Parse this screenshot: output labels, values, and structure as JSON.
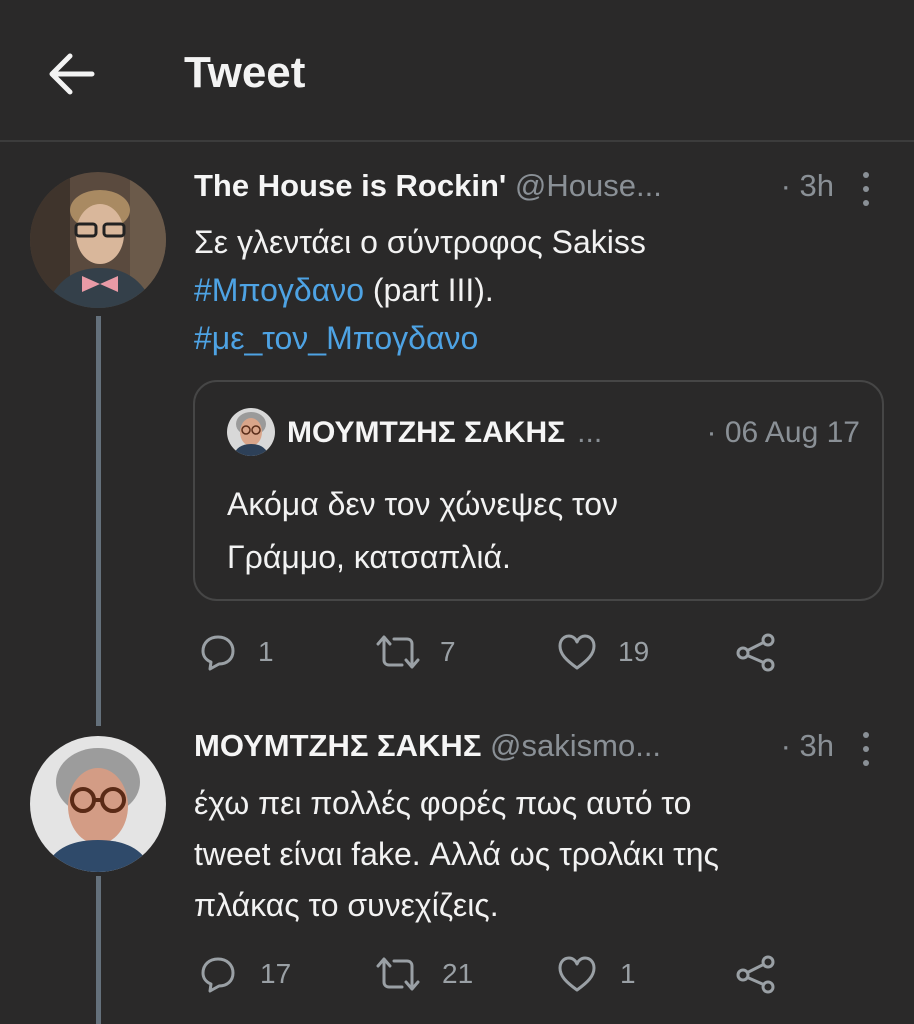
{
  "header": {
    "title": "Tweet"
  },
  "tweets": [
    {
      "name": "The House is Rockin'",
      "handle": "@House...",
      "time": "· 3h",
      "text_line1": "Σε γλεντάει ο σύντροφος Sakiss",
      "hashtag1": "#Μπογδανο",
      "text_after_hashtag1": " (part III).",
      "hashtag2": "#με_τον_Μπογδανο",
      "quote": {
        "name": "ΜΟΥΜΤΖΗΣ ΣΑΚΗΣ",
        "ellipsis": "...",
        "time": "· 06 Aug 17",
        "line1": "Ακόμα δεν τον χώνεψες τον",
        "line2": "Γράμμο, κατσαπλιά."
      },
      "replies": "1",
      "retweets": "7",
      "likes": "19"
    },
    {
      "name": "ΜΟΥΜΤΖΗΣ ΣΑΚΗΣ",
      "handle": "@sakismo...",
      "time": "· 3h",
      "line1": "έχω πει πολλές φορές πως αυτό το",
      "line2": "tweet είναι fake. Αλλά ως τρολάκι της",
      "line3": "πλάκας το συνεχίζεις.",
      "replies": "17",
      "retweets": "21",
      "likes": "1"
    }
  ],
  "colors": {
    "background": "#2a2929",
    "link": "#4ea3e4",
    "muted": "#8a9096",
    "thread": "#64707b"
  },
  "icons": [
    "back-arrow-icon",
    "more-icon",
    "reply-icon",
    "retweet-icon",
    "like-icon",
    "share-icon"
  ]
}
